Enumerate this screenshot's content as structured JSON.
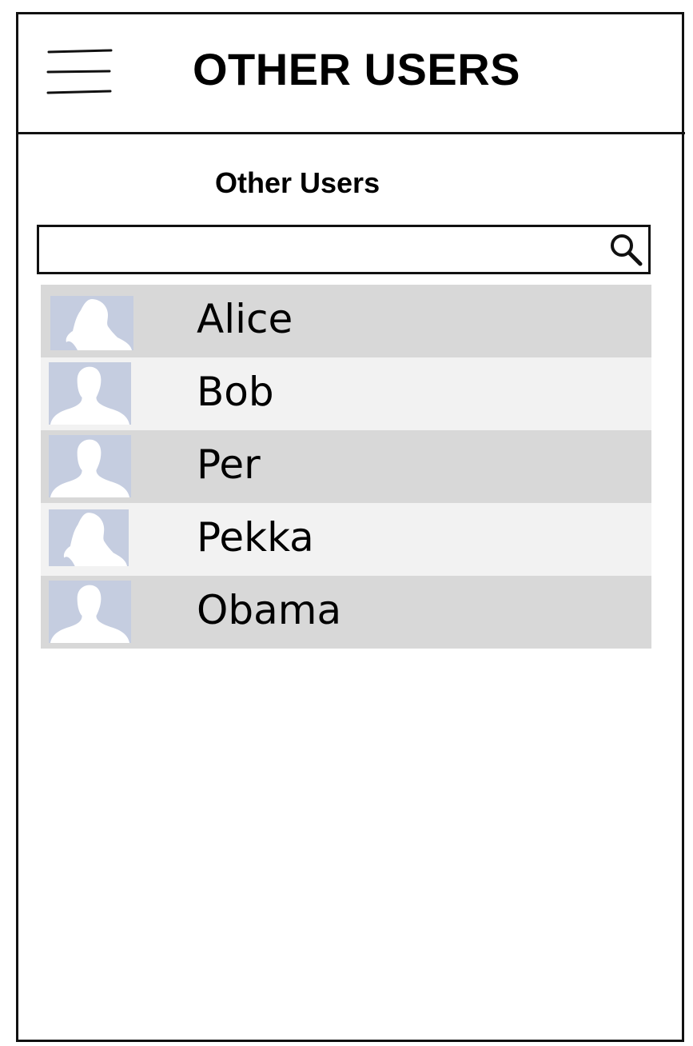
{
  "header": {
    "title": "OTHER USERS",
    "menu_icon": "hamburger-menu-icon"
  },
  "section": {
    "heading": "Other Users"
  },
  "search": {
    "value": "",
    "placeholder": "",
    "icon": "search-icon"
  },
  "users": [
    {
      "name": "Alice",
      "avatar": "female-silhouette-icon"
    },
    {
      "name": "Bob",
      "avatar": "male-silhouette-icon"
    },
    {
      "name": "Per",
      "avatar": "male-silhouette-icon"
    },
    {
      "name": "Pekka",
      "avatar": "female-silhouette-icon"
    },
    {
      "name": "Obama",
      "avatar": "male-silhouette-icon"
    }
  ],
  "colors": {
    "row_dark": "#d8d8d8",
    "row_light": "#f2f2f2",
    "avatar_background": "#c5cde0",
    "border": "#111111"
  }
}
